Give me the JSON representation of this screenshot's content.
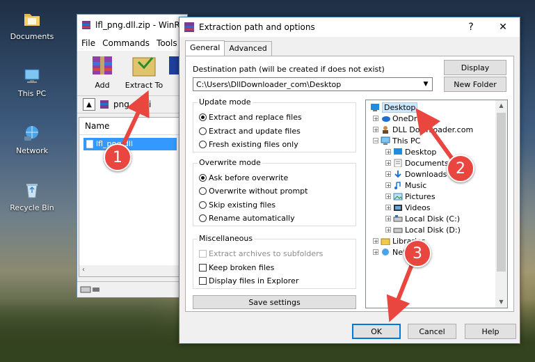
{
  "desktop": {
    "icons": [
      {
        "label": "Documents",
        "icon": "folder-icon"
      },
      {
        "label": "This PC",
        "icon": "computer-icon"
      },
      {
        "label": "Network",
        "icon": "network-icon"
      },
      {
        "label": "Recycle Bin",
        "icon": "recycle-bin-icon"
      }
    ]
  },
  "winrar": {
    "title": "lfl_png.dll.zip - WinR",
    "menu": [
      "File",
      "Commands",
      "Tools"
    ],
    "toolbar": {
      "add": "Add",
      "extract_to": "Extract To"
    },
    "path": "png.dll.zi",
    "column_name": "Name",
    "file": "lfl_png.dll"
  },
  "dialog": {
    "title": "Extraction path and options",
    "help_glyph": "?",
    "close_glyph": "✕",
    "tabs": [
      "General",
      "Advanced"
    ],
    "dest_label": "Destination path (will be created if does not exist)",
    "dest_value": "C:\\Users\\DllDownloader_com\\Desktop",
    "display_button": "Display",
    "new_folder_button": "New Folder",
    "update_mode": {
      "title": "Update mode",
      "options": [
        "Extract and replace files",
        "Extract and update files",
        "Fresh existing files only"
      ],
      "selected": 0
    },
    "overwrite_mode": {
      "title": "Overwrite mode",
      "options": [
        "Ask before overwrite",
        "Overwrite without prompt",
        "Skip existing files",
        "Rename automatically"
      ],
      "selected": 0
    },
    "misc": {
      "title": "Miscellaneous",
      "options": [
        "Extract archives to subfolders",
        "Keep broken files",
        "Display files in Explorer"
      ]
    },
    "save_settings": "Save settings",
    "tree": [
      {
        "label": "Desktop",
        "icon": "desktop-icon"
      },
      {
        "label": "OneDrive",
        "icon": "onedrive-icon"
      },
      {
        "label": "DLL Downloader.com",
        "icon": "user-icon"
      },
      {
        "label": "This PC",
        "icon": "computer-icon"
      },
      {
        "label": "Desktop",
        "icon": "desktop-icon"
      },
      {
        "label": "Documents",
        "icon": "documents-icon"
      },
      {
        "label": "Downloads",
        "icon": "downloads-icon"
      },
      {
        "label": "Music",
        "icon": "music-icon"
      },
      {
        "label": "Pictures",
        "icon": "pictures-icon"
      },
      {
        "label": "Videos",
        "icon": "videos-icon"
      },
      {
        "label": "Local Disk (C:)",
        "icon": "drive-icon"
      },
      {
        "label": "Local Disk (D:)",
        "icon": "drive-icon"
      },
      {
        "label": "Libraries",
        "icon": "library-icon"
      },
      {
        "label": "Network",
        "icon": "network-icon"
      }
    ],
    "ok": "OK",
    "cancel": "Cancel",
    "help": "Help"
  },
  "annotations": [
    "1",
    "2",
    "3"
  ],
  "colors": {
    "accent": "#0078d7",
    "marker": "#e8463e",
    "selection": "#cce8ff"
  }
}
